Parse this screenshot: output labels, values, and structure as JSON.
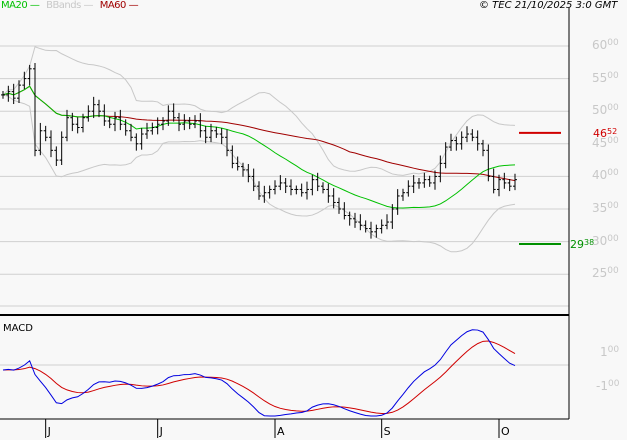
{
  "legend": {
    "ma20": "MA20",
    "bbands": "BBands",
    "ma60": "MA60",
    "colors": {
      "ma20": "#00c000",
      "bbands": "#c8c8c8",
      "ma60": "#a00000"
    }
  },
  "credit": "© TEC 21/10/2025 3:0 GMT",
  "macd_title": "MACD",
  "levels": {
    "resistance": {
      "int": "46",
      "dec": "52",
      "value": 46.52,
      "color": "#d00000"
    },
    "support": {
      "int": "29",
      "dec": "38",
      "value": 29.38,
      "color": "#009000"
    }
  },
  "chart_data": {
    "type": "line",
    "title": "",
    "y_ticks": [
      {
        "v": 60,
        "i": "60",
        "d": "00"
      },
      {
        "v": 55,
        "i": "55",
        "d": "00"
      },
      {
        "v": 50,
        "i": "50",
        "d": "00"
      },
      {
        "v": 45,
        "i": "45",
        "d": "00"
      },
      {
        "v": 40,
        "i": "40",
        "d": "00"
      },
      {
        "v": 35,
        "i": "35",
        "d": "00"
      },
      {
        "v": 30,
        "i": "30",
        "d": "00"
      },
      {
        "v": 25,
        "i": "25",
        "d": "00"
      }
    ],
    "ylim": [
      21,
      64
    ],
    "macd_ticks": [
      {
        "v": 1,
        "i": "1",
        "d": "00"
      },
      {
        "v": -1,
        "i": "-1",
        "d": "00"
      }
    ],
    "x_labels": [
      {
        "label": "J",
        "index": 8
      },
      {
        "label": "J",
        "index": 29
      },
      {
        "label": "A",
        "index": 51
      },
      {
        "label": "S",
        "index": 71
      },
      {
        "label": "O",
        "index": 93
      }
    ],
    "closes": [
      52.5,
      53,
      52,
      54,
      55,
      56.5,
      44,
      47,
      46,
      44,
      42.5,
      46,
      49,
      48,
      47.5,
      49,
      50,
      51,
      50,
      48.5,
      48,
      49,
      48,
      47,
      46,
      45,
      46.5,
      47,
      47.5,
      48,
      48.5,
      50,
      49,
      48,
      48.5,
      48,
      48.5,
      47,
      46,
      47,
      46.5,
      46,
      44,
      42,
      41.5,
      41,
      40,
      38.5,
      37,
      37.5,
      38,
      38.5,
      39,
      38.5,
      38,
      38,
      37.5,
      38,
      39.5,
      38.5,
      38,
      37,
      36,
      35,
      34,
      33.5,
      33,
      32.5,
      32,
      31.5,
      32,
      32.5,
      33,
      35,
      37,
      37.5,
      38.5,
      39,
      39,
      39.5,
      39,
      40,
      42,
      44.5,
      45.5,
      45,
      46,
      46.5,
      46,
      45,
      44,
      40,
      38,
      39.5,
      39,
      38.5,
      39.5
    ],
    "series": [
      {
        "name": "MA20",
        "period": 20
      },
      {
        "name": "BBands",
        "period": 20,
        "k": 2
      },
      {
        "name": "MA60",
        "period": 60
      },
      {
        "name": "MACD",
        "fast": 12,
        "slow": 26,
        "signal": 9
      }
    ]
  }
}
